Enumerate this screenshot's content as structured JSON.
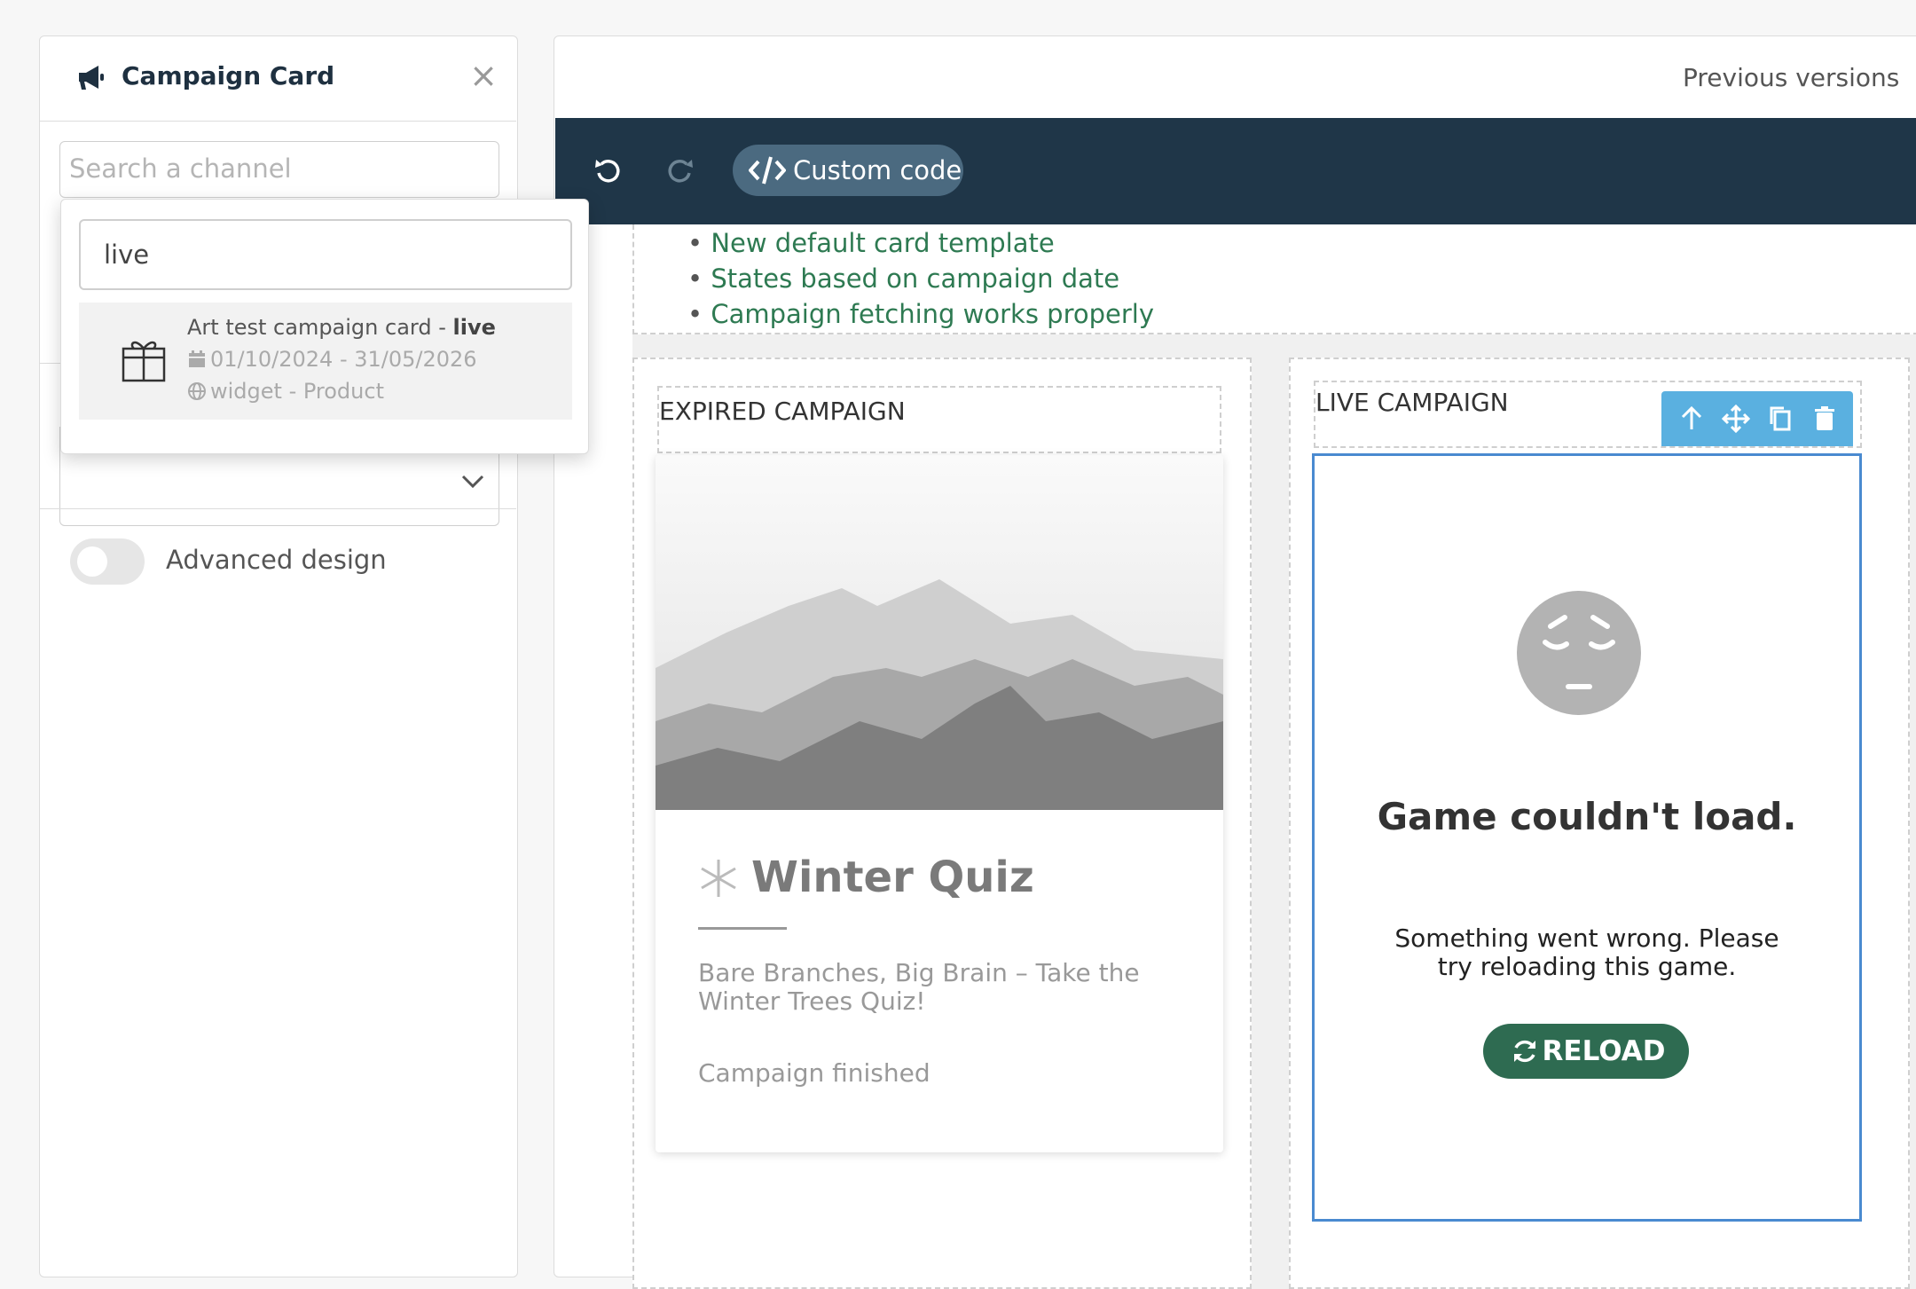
{
  "left_panel": {
    "title": "Campaign Card",
    "search_placeholder": "Search a channel",
    "advanced_design_label": "Advanced design"
  },
  "dropdown": {
    "query": "live",
    "result": {
      "name_prefix": "Art test campaign card - ",
      "name_highlight": "live",
      "dates": "01/10/2024 - 31/05/2026",
      "type": "widget - Product"
    }
  },
  "editor": {
    "previous_versions": "Previous versions",
    "toolbar": {
      "custom_code": "Custom code"
    },
    "notes": [
      "New default card template",
      "States based on campaign date",
      "Campaign fetching works properly"
    ],
    "expired": {
      "label": "EXPIRED CAMPAIGN",
      "card_title": "Winter Quiz",
      "card_desc": "Bare Branches, Big Brain – Take the Winter Trees Quiz!",
      "card_status": "Campaign finished"
    },
    "live": {
      "label": "LIVE CAMPAIGN",
      "error_title": "Game couldn't load.",
      "error_msg": "Something went wrong. Please try reloading this game.",
      "reload": "RELOAD"
    }
  },
  "colors": {
    "toolbar_bg": "#1f3648",
    "accent_green": "#2e6b51",
    "selection_blue": "#4a8ad0",
    "block_toolbar": "#5ab0e0"
  }
}
